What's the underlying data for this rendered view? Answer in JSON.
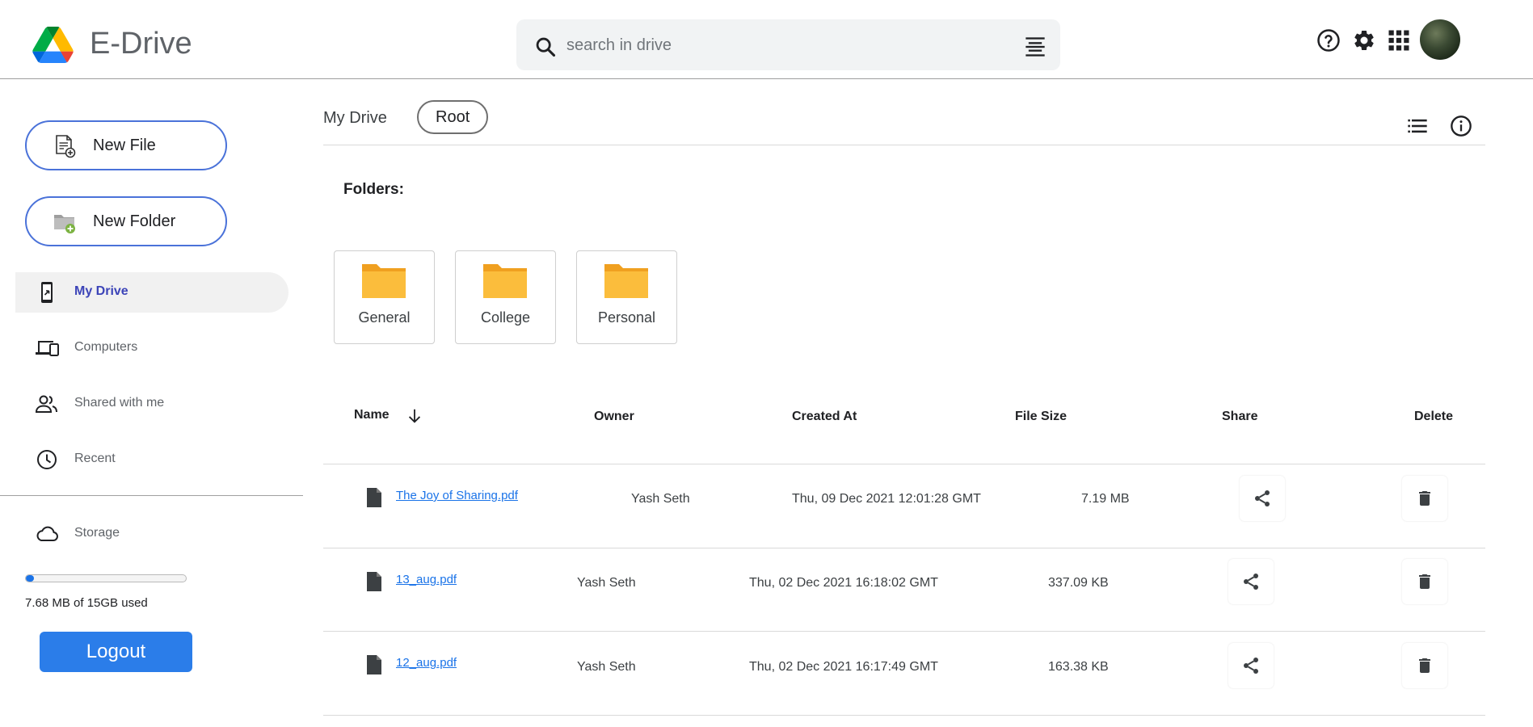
{
  "header": {
    "app_title": "E-Drive",
    "search_placeholder": "search in drive"
  },
  "sidebar": {
    "new_file_label": "New File",
    "new_folder_label": "New Folder",
    "nav": [
      {
        "label": "My Drive",
        "icon": "phone-drive-icon",
        "active": true
      },
      {
        "label": "Computers",
        "icon": "computers-icon",
        "active": false
      },
      {
        "label": "Shared with me",
        "icon": "people-icon",
        "active": false
      },
      {
        "label": "Recent",
        "icon": "clock-icon",
        "active": false
      }
    ],
    "storage_label": "Storage",
    "storage_used_fraction": 0.0005,
    "storage_text": "7.68 MB of 15GB used",
    "logout_label": "Logout"
  },
  "main": {
    "breadcrumb": {
      "my_drive": "My Drive",
      "current": "Root"
    },
    "folders_label": "Folders:",
    "folders": [
      "General",
      "College",
      "Personal"
    ],
    "table": {
      "headers": {
        "name": "Name",
        "owner": "Owner",
        "created": "Created At",
        "size": "File Size",
        "share": "Share",
        "delete": "Delete"
      },
      "rows": [
        {
          "name": "The Joy of Sharing.pdf",
          "owner": "Yash Seth",
          "created": "Thu, 09 Dec 2021 12:01:28 GMT",
          "size": "7.19 MB"
        },
        {
          "name": "13_aug.pdf",
          "owner": "Yash Seth",
          "created": "Thu, 02 Dec 2021 16:18:02 GMT",
          "size": "337.09 KB"
        },
        {
          "name": "12_aug.pdf",
          "owner": "Yash Seth",
          "created": "Thu, 02 Dec 2021 16:17:49 GMT",
          "size": "163.38 KB"
        }
      ]
    }
  },
  "colors": {
    "accent": "#1a73e8",
    "pill_border": "#4a72d9",
    "active_nav_text": "#3c44b8",
    "folder_yellow": "#f9b233"
  }
}
